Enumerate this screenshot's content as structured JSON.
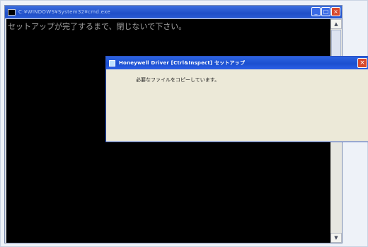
{
  "console": {
    "title": "C:¥WINDOWS¥System32¥cmd.exe",
    "output_line": "セットアップが完了するまで、閉じないで下さい。",
    "controls": {
      "minimize": "_",
      "maximize": "□",
      "close": "×"
    },
    "scroll": {
      "up": "▲",
      "down": "▼"
    }
  },
  "dialog": {
    "title": "Honeywell Driver [Ctrl&Inspect] セットアップ",
    "close": "×",
    "message": "必要なファイルをコピーしています。"
  }
}
